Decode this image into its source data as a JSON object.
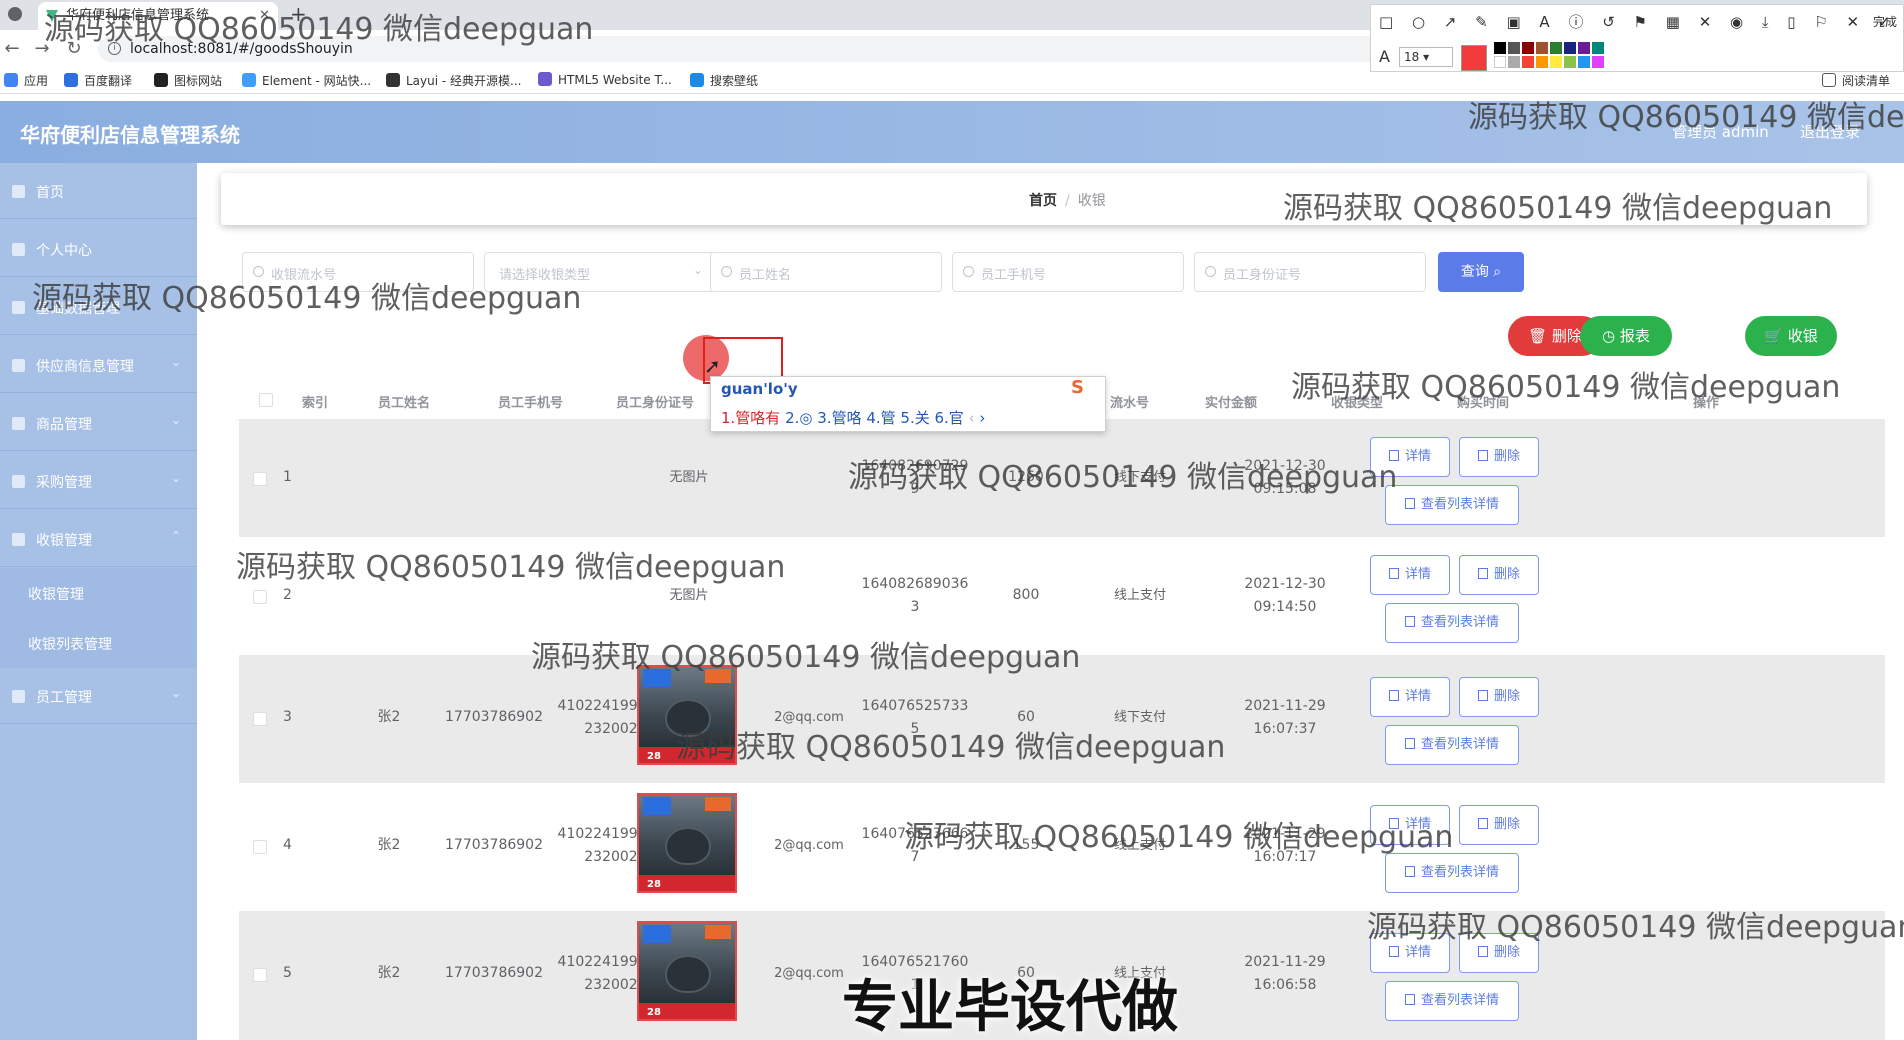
{
  "browser": {
    "tab_title": "华府便利店信息管理系统",
    "url": "localhost:8081/#/goodsShouyin",
    "bookmarks": [
      "应用",
      "百度翻译",
      "图标网站",
      "Element - 网站快...",
      "Layui - 经典开源模...",
      "HTML5 Website T...",
      "搜索壁纸"
    ],
    "reading_list": "阅读清单"
  },
  "snip_toolbar": {
    "tool_icons": "□ ○ ↗ ✎ ▣ A ⓘ ↺ ⚑ ▦ ✕ ◉ ⤓ ▯ ⚐ ✕ ✓",
    "done_label": "完成",
    "font_size": "18"
  },
  "app": {
    "title": "华府便利店信息管理系统",
    "user": "管理员 admin",
    "logout": "退出登录"
  },
  "sidebar": {
    "items": [
      {
        "label": "首页"
      },
      {
        "label": "个人中心"
      },
      {
        "label": "基础数据管理"
      },
      {
        "label": "供应商信息管理"
      },
      {
        "label": "商品管理"
      },
      {
        "label": "采购管理"
      },
      {
        "label": "收银管理"
      }
    ],
    "sub_items": [
      {
        "label": "收银管理"
      },
      {
        "label": "收银列表管理"
      }
    ],
    "last_item": {
      "label": "员工管理"
    }
  },
  "breadcrumb": {
    "home": "首页",
    "separator": "/",
    "current": "收银"
  },
  "search": {
    "serial_placeholder": "收银流水号",
    "type_placeholder": "请选择收银类型",
    "name_placeholder": "员工姓名",
    "phone_placeholder": "员工手机号",
    "idcard_placeholder": "员工身份证号",
    "query_label": "查询"
  },
  "actions": {
    "delete": "删除",
    "report": "报表",
    "cashier": "收银"
  },
  "table": {
    "headers": {
      "index": "索引",
      "name": "员工姓名",
      "phone": "员工手机号",
      "idcard": "员工身份证号",
      "serial": "流水号",
      "amount": "实付金额",
      "type": "收银类型",
      "time": "购买时间",
      "ops": "操作"
    },
    "rows": [
      {
        "index": "1",
        "name": "",
        "phone": "",
        "idcard": "",
        "photo": "无图片",
        "email": "",
        "serial": "164082690729 9",
        "amount": "1260",
        "type": "线下支付",
        "time": "2021-12-30 09:15:08"
      },
      {
        "index": "2",
        "name": "",
        "phone": "",
        "idcard": "",
        "photo": "无图片",
        "email": "",
        "serial": "164082689036 3",
        "amount": "800",
        "type": "线上支付",
        "time": "2021-12-30 09:14:50"
      },
      {
        "index": "3",
        "name": "张2",
        "phone": "17703786902",
        "idcard": "410224199610 232002",
        "photo": "",
        "email": "2@qq.com",
        "serial": "164076525733 5",
        "amount": "60",
        "type": "线下支付",
        "time": "2021-11-29 16:07:37"
      },
      {
        "index": "4",
        "name": "张2",
        "phone": "17703786902",
        "idcard": "410224199610 232002",
        "photo": "",
        "email": "2@qq.com",
        "serial": "164076523666 7",
        "amount": "155",
        "type": "线上支付",
        "time": "2021-11-29 16:07:17"
      },
      {
        "index": "5",
        "name": "张2",
        "phone": "17703786902",
        "idcard": "410224199610 232002",
        "photo": "",
        "email": "2@qq.com",
        "serial": "164076521760 1",
        "amount": "60",
        "type": "线上支付",
        "time": "2021-11-29 16:06:58"
      }
    ],
    "thumb_num": "28",
    "row_actions": {
      "detail": "详情",
      "delete": "删除",
      "list_detail": "查看列表详情"
    }
  },
  "ime": {
    "pinyin": "guan'lo'y",
    "cand1": "1.管咯有",
    "rest": "2.◎ 3.管咯 4.管 5.关 6.官",
    "nav_prev": "‹",
    "nav_next": "›"
  },
  "watermark": {
    "text": "源码获取 QQ86050149 微信deepguan",
    "banner": "专业毕设代做"
  },
  "colors": {
    "header_bg": "#8aaee0",
    "sidebar_bg": "#a7c0e6",
    "primary": "#5b7be8",
    "danger": "#e23b3b",
    "success": "#2bb24c"
  }
}
